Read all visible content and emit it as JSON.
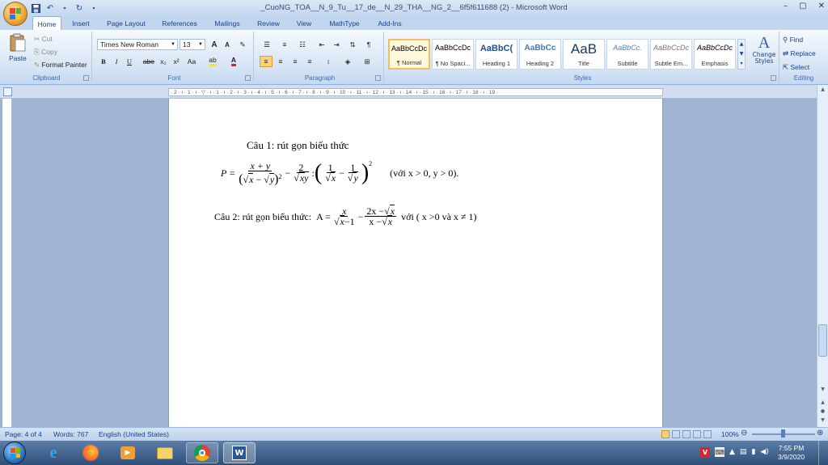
{
  "window": {
    "title": "_CuoNG_TOA__N_9_Tu__17_de__N_29_THA__NG_2__6f5f611688 (2) - Microsoft Word",
    "controls": [
      "–",
      "▢",
      "✕"
    ]
  },
  "quick_access": {
    "save_icon": "save-icon",
    "undo_icon": "undo-icon",
    "redo_icon": "redo-icon"
  },
  "tabs": [
    "Home",
    "Insert",
    "Page Layout",
    "References",
    "Mailings",
    "Review",
    "View",
    "MathType",
    "Add-Ins"
  ],
  "active_tab": "Home",
  "clipboard": {
    "paste": "Paste",
    "cut": "Cut",
    "copy": "Copy",
    "format_painter": "Format Painter",
    "label": "Clipboard"
  },
  "font": {
    "family": "Times New Roman",
    "size": "13",
    "label": "Font",
    "bold": "B",
    "italic": "I",
    "underline": "U",
    "strike": "abe",
    "subscript": "x₂",
    "superscript": "x²",
    "change_case": "Aa",
    "grow": "A",
    "shrink": "A"
  },
  "paragraph": {
    "label": "Paragraph"
  },
  "styles": {
    "label": "Styles",
    "items": [
      {
        "preview": "AaBbCcDc",
        "name": "¶ Normal"
      },
      {
        "preview": "AaBbCcDc",
        "name": "¶ No Spaci..."
      },
      {
        "preview": "AaBbC(",
        "name": "Heading 1"
      },
      {
        "preview": "AaBbCc",
        "name": "Heading 2"
      },
      {
        "preview": "AaB",
        "name": "Title"
      },
      {
        "preview": "AaBbCc.",
        "name": "Subtitle"
      },
      {
        "preview": "AaBbCcDc",
        "name": "Subtle Em..."
      },
      {
        "preview": "AaBbCcDc",
        "name": "Emphasis"
      }
    ],
    "change_styles": "Change Styles"
  },
  "editing": {
    "find": "Find",
    "replace": "Replace",
    "select": "Select",
    "label": "Editing"
  },
  "ruler_text": "· 2 · ı · 1 · ı · ▽ · ı · 1 · ı · 2 · ı · 3 · ı · 4 · ı · 5 · ı · 6 · ı · 7 · ı · 8 · ı · 9 · ı · 10 · ı · 11 · ı · 12 · ı · 13 · ı · 14 · ı · 15 · ı · 16 · ı · 17 · ı · 18 · ı · 19 ·",
  "document": {
    "q1_title": "Câu 1: rút gọn biểu thức",
    "q1_P": "P =",
    "q1_num1": "x + y",
    "q1_den1a": "x",
    "q1_den1b": "y",
    "q1_minus": "−",
    "q1_num2": "2",
    "q1_den2": "xy",
    "q1_colon": ":",
    "q1_num3": "1",
    "q1_den3": "x",
    "q1_num4": "1",
    "q1_den4": "y",
    "q1_exp": "2",
    "q1_cond": "(với  x > 0,  y > 0).",
    "q2_label": "Câu 2: rút gọn biểu thức:",
    "q2_A": "A =",
    "q2_num1": "x",
    "q2_den1a": "x",
    "q2_den1b": "−1",
    "q2_num2a": "2x −",
    "q2_num2b": "x",
    "q2_den2a": "x −",
    "q2_den2b": "x",
    "q2_cond": "với ( x >0 và x ≠ 1)"
  },
  "status": {
    "page": "Page: 4 of 4",
    "words": "Words: 767",
    "language": "English (United States)",
    "zoom": "100%"
  },
  "taskbar": {
    "time": "7:55 PM",
    "date": "3/9/2020"
  }
}
